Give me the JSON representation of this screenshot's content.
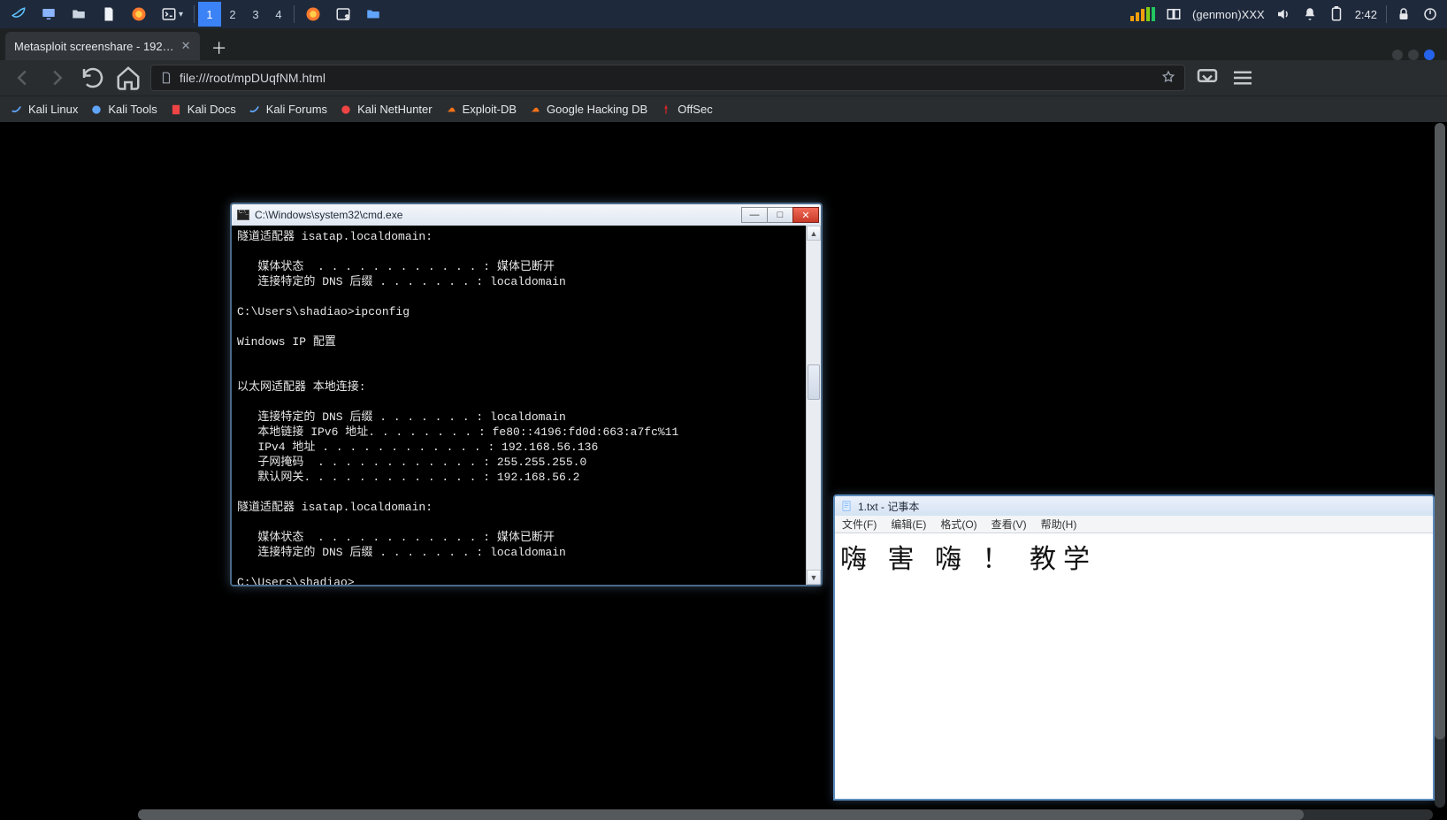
{
  "taskbar": {
    "workspaces": [
      "1",
      "2",
      "3",
      "4"
    ],
    "active_workspace_index": 0,
    "genmon": "(genmon)XXX",
    "clock": "2:42"
  },
  "browser": {
    "tab_title": "Metasploit screenshare - 192…",
    "url": "file:///root/mpDUqfNM.html",
    "bookmarks": [
      "Kali Linux",
      "Kali Tools",
      "Kali Docs",
      "Kali Forums",
      "Kali NetHunter",
      "Exploit-DB",
      "Google Hacking DB",
      "OffSec"
    ]
  },
  "cmd": {
    "title": "C:\\Windows\\system32\\cmd.exe",
    "lines": [
      "隧道适配器 isatap.localdomain:",
      "",
      "   媒体状态  . . . . . . . . . . . . : 媒体已断开",
      "   连接特定的 DNS 后缀 . . . . . . . : localdomain",
      "",
      "C:\\Users\\shadiao>ipconfig",
      "",
      "Windows IP 配置",
      "",
      "",
      "以太网适配器 本地连接:",
      "",
      "   连接特定的 DNS 后缀 . . . . . . . : localdomain",
      "   本地链接 IPv6 地址. . . . . . . . : fe80::4196:fd0d:663:a7fc%11",
      "   IPv4 地址 . . . . . . . . . . . . : 192.168.56.136",
      "   子网掩码  . . . . . . . . . . . . : 255.255.255.0",
      "   默认网关. . . . . . . . . . . . . : 192.168.56.2",
      "",
      "隧道适配器 isatap.localdomain:",
      "",
      "   媒体状态  . . . . . . . . . . . . : 媒体已断开",
      "   连接特定的 DNS 后缀 . . . . . . . : localdomain",
      "",
      "C:\\Users\\shadiao>_"
    ]
  },
  "notepad": {
    "title": "1.txt - 记事本",
    "menus": [
      "文件(F)",
      "编辑(E)",
      "格式(O)",
      "查看(V)",
      "帮助(H)"
    ],
    "content": "嗨 害 嗨 ！ 教学"
  }
}
